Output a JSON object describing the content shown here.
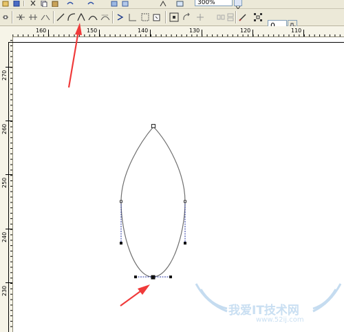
{
  "toolbar": {
    "zoom_value": "300%"
  },
  "property_bar": {
    "angle_value": "0"
  },
  "rulers": {
    "horizontal_labels": [
      "160",
      "150",
      "140",
      "130",
      "120",
      "110"
    ],
    "vertical_labels": [
      "270",
      "260",
      "250",
      "240",
      "230"
    ]
  },
  "watermark": {
    "text": "我爱IT技术网",
    "url": "www.52ij.com"
  },
  "colors": {
    "chrome": "#ece9d8",
    "curve": "#6f6f6f",
    "control_line": "#1f2f9f",
    "annotation_arrow": "#f03a3a"
  }
}
